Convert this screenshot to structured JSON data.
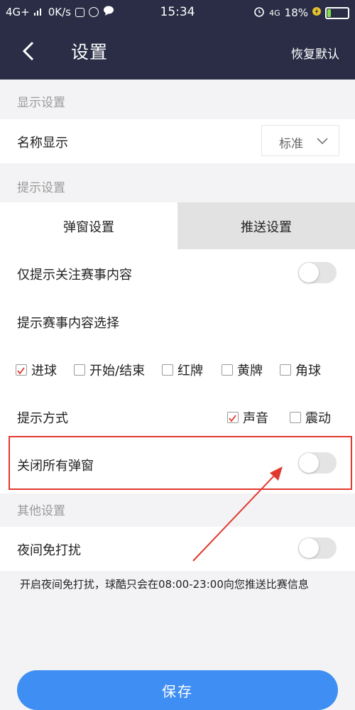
{
  "status_bar": {
    "network": "4G+",
    "speed": "0K/s",
    "time": "15:34",
    "network_right": "4G",
    "battery": "18%",
    "battery_level": 0.18
  },
  "header": {
    "title": "设置",
    "reset_label": "恢复默认"
  },
  "display_settings": {
    "section_title": "显示设置",
    "name_display_label": "名称显示",
    "name_display_value": "标准"
  },
  "notify_settings": {
    "section_title": "提示设置",
    "tabs": [
      {
        "label": "弹窗设置",
        "active": true
      },
      {
        "label": "推送设置",
        "active": false
      }
    ],
    "only_followed_label": "仅提示关注赛事内容",
    "only_followed_on": false,
    "content_select_label": "提示赛事内容选择",
    "content_options": [
      {
        "label": "进球",
        "checked": true
      },
      {
        "label": "开始/结束",
        "checked": false
      },
      {
        "label": "红牌",
        "checked": false
      },
      {
        "label": "黄牌",
        "checked": false
      },
      {
        "label": "角球",
        "checked": false
      }
    ],
    "method_label": "提示方式",
    "methods": [
      {
        "label": "声音",
        "checked": true
      },
      {
        "label": "震动",
        "checked": false
      }
    ],
    "close_all_label": "关闭所有弹窗",
    "close_all_on": false
  },
  "other_settings": {
    "section_title": "其他设置",
    "night_mode_label": "夜间免打扰",
    "night_mode_on": false,
    "note": "开启夜间免打扰，球酷只会在08:00-23:00向您推送比赛信息"
  },
  "save_label": "保存",
  "colors": {
    "header_bg": "#2a2d45",
    "accent": "#3e8ef3",
    "highlight": "#e0392f"
  }
}
